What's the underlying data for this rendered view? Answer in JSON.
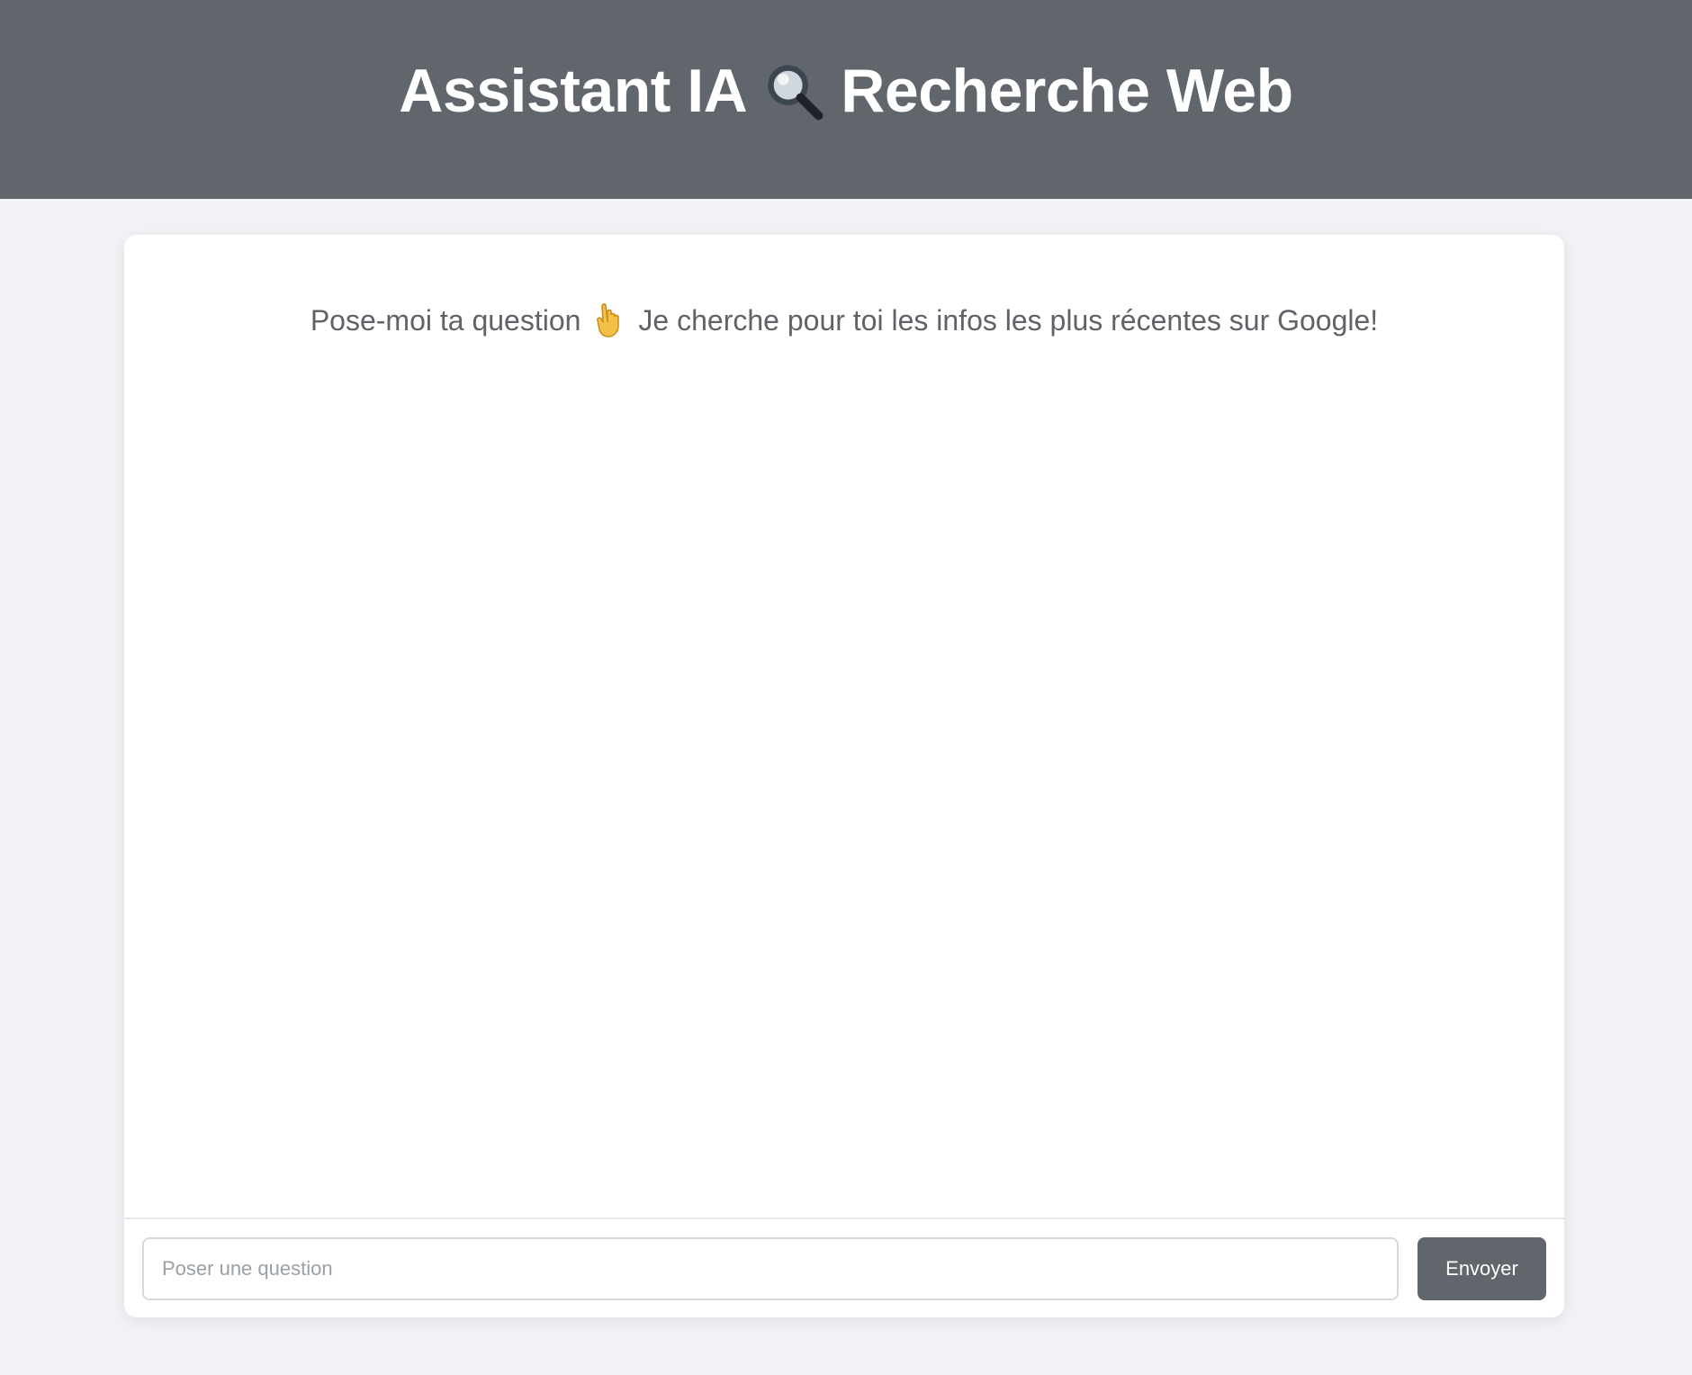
{
  "header": {
    "title_part1": "Assistant IA",
    "title_icon": "magnifier-icon",
    "title_part2": "Recherche Web",
    "background_color": "#61666d"
  },
  "main": {
    "intro_part1": "Pose-moi ta question",
    "intro_icon": "pointing-down-hand-icon",
    "intro_part2": "Je cherche pour toi les infos les plus récentes sur Google!"
  },
  "input_bar": {
    "placeholder": "Poser une question",
    "value": "",
    "send_label": "Envoyer",
    "button_color": "#61666d"
  }
}
